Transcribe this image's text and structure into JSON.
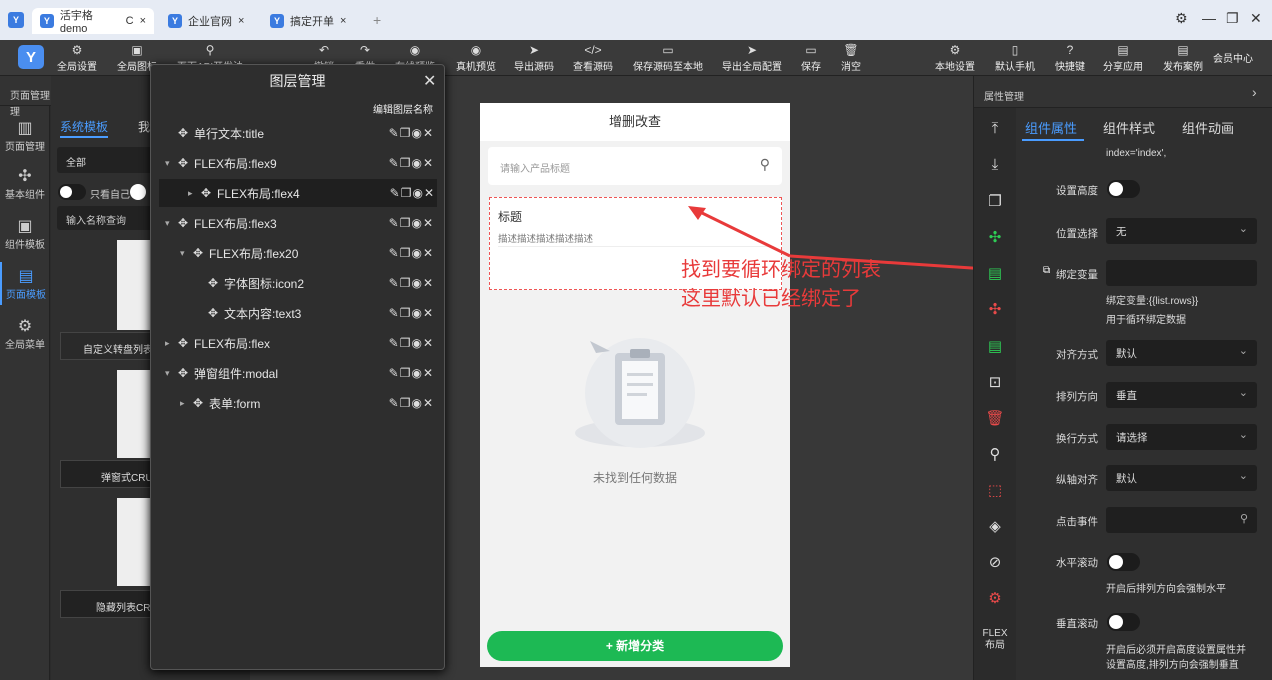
{
  "browser": {
    "tabs": [
      {
        "label": "活宇格demo",
        "active": true
      },
      {
        "label": "企业官网",
        "active": false
      },
      {
        "label": "搞定开单",
        "active": false
      }
    ],
    "reload": "C",
    "close": "×",
    "newtab": "+"
  },
  "toolbar": {
    "left": [
      {
        "icon": "gear-icon",
        "label": "全局设置"
      },
      {
        "icon": "image-icon",
        "label": "全局图标"
      },
      {
        "icon": "link-icon",
        "label": "页面API开发法"
      },
      {
        "icon": "undo-icon",
        "label": "撤销"
      },
      {
        "icon": "redo-icon",
        "label": "重做"
      },
      {
        "icon": "eye-icon",
        "label": "在线预览"
      },
      {
        "icon": "eye-icon",
        "label": "真机预览"
      },
      {
        "icon": "send-icon",
        "label": "导出源码"
      },
      {
        "icon": "code-icon",
        "label": "查看源码"
      },
      {
        "icon": "save-icon",
        "label": "保存源码至本地"
      },
      {
        "icon": "send-icon",
        "label": "导出全局配置"
      },
      {
        "icon": "save-icon",
        "label": "保存"
      },
      {
        "icon": "trash-icon",
        "label": "消空"
      }
    ],
    "right": [
      {
        "icon": "gear-icon",
        "label": "本地设置"
      },
      {
        "icon": "phone-icon",
        "label": "默认手机"
      },
      {
        "icon": "help-icon",
        "label": "快捷键"
      },
      {
        "icon": "share-icon",
        "label": "分享应用"
      },
      {
        "icon": "publish-icon",
        "label": "发布案例"
      }
    ],
    "member": "会员中心"
  },
  "leftnav": {
    "header": "页面管理",
    "items": [
      {
        "label": "页面管理"
      },
      {
        "label": "基本组件"
      },
      {
        "label": "组件模板"
      },
      {
        "label": "页面模板"
      },
      {
        "label": "全局菜单"
      }
    ]
  },
  "leftpanel": {
    "tabs": [
      "系统模板",
      "我"
    ],
    "filter": "全部",
    "only_mine": "只看自己",
    "search_placeholder": "输入名称查询",
    "cards": [
      "自定义转盘列表",
      "弹窗式CRU",
      "隐藏列表CR"
    ]
  },
  "layer": {
    "title": "图层管理",
    "edit_label": "编辑图层名称",
    "rows": [
      {
        "label": "单行文本:title",
        "indent": 0,
        "arrow": ""
      },
      {
        "label": "FLEX布局:flex9",
        "indent": 0,
        "arrow": "▾"
      },
      {
        "label": "FLEX布局:flex4",
        "indent": 1,
        "arrow": "▸",
        "selected": true
      },
      {
        "label": "FLEX布局:flex3",
        "indent": 0,
        "arrow": "▾"
      },
      {
        "label": "FLEX布局:flex20",
        "indent": 1,
        "arrow": "▾"
      },
      {
        "label": "字体图标:icon2",
        "indent": 2,
        "arrow": ""
      },
      {
        "label": "文本内容:text3",
        "indent": 2,
        "arrow": ""
      },
      {
        "label": "FLEX布局:flex",
        "indent": 0,
        "arrow": "▸"
      },
      {
        "label": "弹窗组件:modal",
        "indent": 0,
        "arrow": "▾"
      },
      {
        "label": "表单:form",
        "indent": 1,
        "arrow": "▸"
      }
    ]
  },
  "phone": {
    "title": "增删改查",
    "search_placeholder": "请输入产品标题",
    "item_title": "标题",
    "item_desc": "描述描述描述描述描述",
    "empty": "未找到任何数据",
    "add_button": "+ 新增分类"
  },
  "annotation": {
    "line1": "找到要循环绑定的列表",
    "line2": "这里默认已经绑定了",
    "color": "#e83a3a"
  },
  "right": {
    "header": "属性管理",
    "tabs": [
      "组件属性",
      "组件样式",
      "组件动画"
    ],
    "top_hint": "index='index',",
    "height_label": "设置高度",
    "position_label": "位置选择",
    "position_value": "无",
    "bind_label": "绑定变量",
    "bind_value": "",
    "bind_hint1": "绑定变量:{{list.rows}}",
    "bind_hint2": "用于循环绑定数据",
    "align_label": "对齐方式",
    "align_value": "默认",
    "direction_label": "排列方向",
    "direction_value": "垂直",
    "wrap_label": "换行方式",
    "wrap_value": "请选择",
    "cross_label": "纵轴对齐",
    "cross_value": "默认",
    "click_label": "点击事件",
    "click_value": "",
    "hscroll_label": "水平滚动",
    "hscroll_hint": "开启后排列方向会强制水平",
    "vscroll_label": "垂直滚动",
    "vscroll_hint1": "开启后必须开启高度设置属性并",
    "vscroll_hint2": "设置高度,排列方向会强制垂直",
    "flex_label1": "FLEX",
    "flex_label2": "布局"
  }
}
